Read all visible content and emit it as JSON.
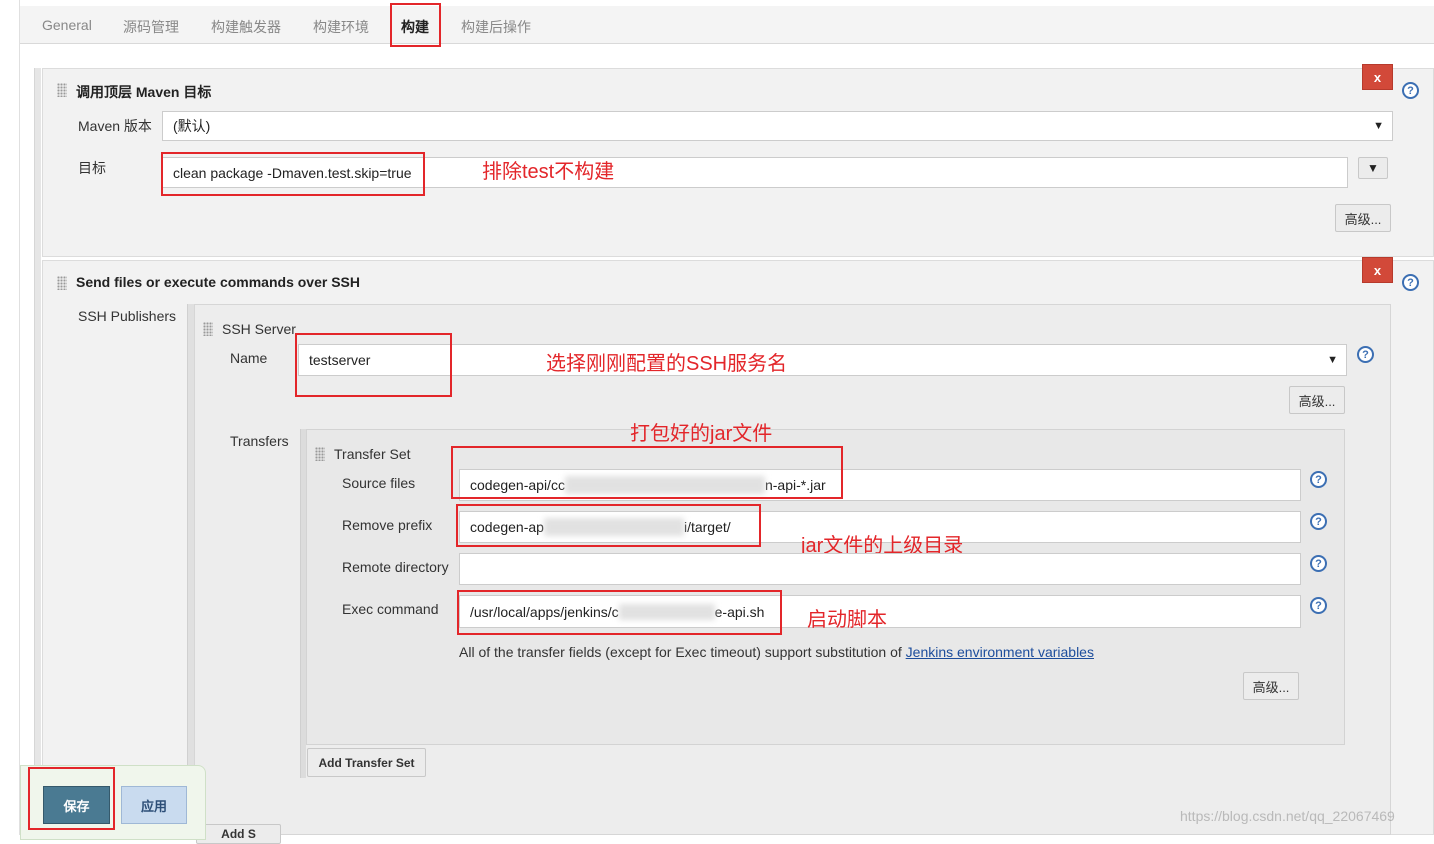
{
  "tabs": [
    {
      "label": "General"
    },
    {
      "label": "源码管理"
    },
    {
      "label": "构建触发器"
    },
    {
      "label": "构建环境"
    },
    {
      "label": "构建"
    },
    {
      "label": "构建后操作"
    }
  ],
  "maven": {
    "title": "调用顶层 Maven 目标",
    "version_label": "Maven 版本",
    "version_value": "(默认)",
    "goals_label": "目标",
    "goals_value": "clean package -Dmaven.test.skip=true",
    "expand_symbol": "▼",
    "advanced_label": "高级...",
    "delete_label": "x"
  },
  "ssh": {
    "title": "Send files or execute commands over SSH",
    "publishers_label": "SSH Publishers",
    "server_title": "SSH Server",
    "name_label": "Name",
    "name_value": "testserver",
    "advanced_label": "高级...",
    "delete_label": "x",
    "transfers_label": "Transfers",
    "transfer_set": {
      "title": "Transfer Set",
      "source_files_label": "Source files",
      "source_files_prefix": "codegen-api/cc",
      "source_files_suffix": "n-api-*.jar",
      "remove_prefix_label": "Remove prefix",
      "remove_prefix_prefix": "codegen-ap",
      "remove_prefix_suffix": "i/target/",
      "remote_directory_label": "Remote directory",
      "remote_directory_value": "",
      "exec_command_label": "Exec command",
      "exec_command_prefix": "/usr/local/apps/jenkins/c",
      "exec_command_suffix": "e-api.sh",
      "note_text": "All of the transfer fields (except for Exec timeout) support substitution of ",
      "note_link": "Jenkins environment variables",
      "advanced_label": "高级..."
    },
    "add_transfer_set_label": "Add Transfer Set",
    "add_server_label": "Add S"
  },
  "help_symbol": "?",
  "buttons": {
    "save": "保存",
    "apply": "应用"
  },
  "annotations": {
    "exclude_test": "排除test不构建",
    "select_ssh": "选择刚刚配置的SSH服务名",
    "packaged_jar": "打包好的jar文件",
    "jar_parent_dir": "jar文件的上级目录",
    "start_script": "启动脚本"
  },
  "watermark": "https://blog.csdn.net/qq_22067469",
  "colors": {
    "annotation_red": "#e3262a",
    "delete_red": "#d24939",
    "save_blue": "#4a7a92",
    "apply_blue": "#c9dbef",
    "help_blue": "#3c6fb3"
  }
}
